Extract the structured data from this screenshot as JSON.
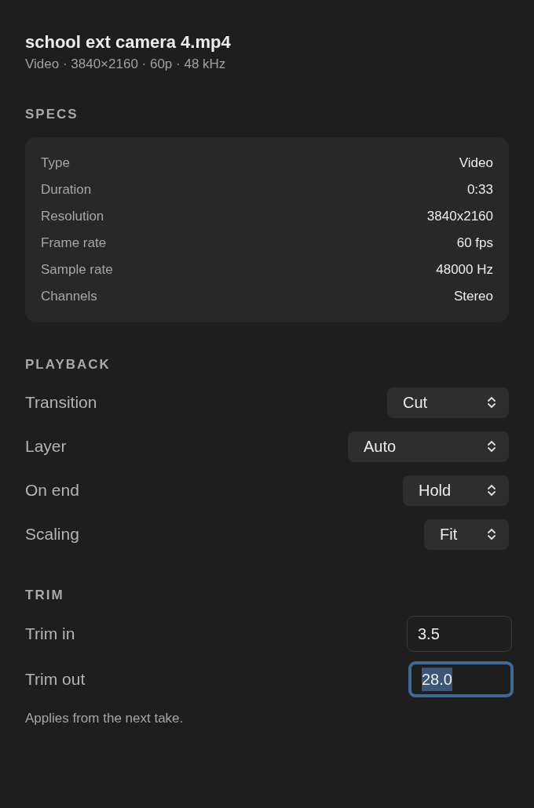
{
  "header": {
    "title": "school ext camera 4.mp4",
    "subtitle": "Video · 3840×2160 · 60p · 48 kHz"
  },
  "specs": {
    "heading": "SPECS",
    "rows": [
      {
        "label": "Type",
        "value": "Video"
      },
      {
        "label": "Duration",
        "value": "0:33"
      },
      {
        "label": "Resolution",
        "value": "3840x2160"
      },
      {
        "label": "Frame rate",
        "value": "60 fps"
      },
      {
        "label": "Sample rate",
        "value": "48000 Hz"
      },
      {
        "label": "Channels",
        "value": "Stereo"
      }
    ]
  },
  "playback": {
    "heading": "PLAYBACK",
    "rows": [
      {
        "label": "Transition",
        "value": "Cut"
      },
      {
        "label": "Layer",
        "value": "Auto"
      },
      {
        "label": "On end",
        "value": "Hold"
      },
      {
        "label": "Scaling",
        "value": "Fit"
      }
    ]
  },
  "trim": {
    "heading": "TRIM",
    "fields": [
      {
        "label": "Trim in",
        "value": "3.5",
        "focused": false
      },
      {
        "label": "Trim out",
        "value": "28.0",
        "focused": true
      }
    ],
    "note": "Applies from the next take."
  }
}
